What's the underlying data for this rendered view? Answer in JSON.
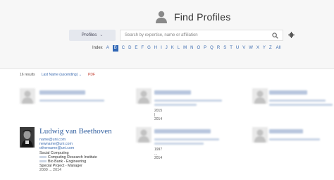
{
  "header": {
    "title": "Find Profiles",
    "title_icon": "person-icon"
  },
  "search": {
    "dropdown_label": "Profiles",
    "placeholder": "Search by expertise, name or affiliation",
    "search_icon": "search-icon",
    "settings_icon": "gear-icon"
  },
  "index": {
    "label": "Index",
    "letters": [
      "A",
      "B",
      "C",
      "D",
      "E",
      "F",
      "G",
      "H",
      "I",
      "J",
      "K",
      "L",
      "M",
      "N",
      "O",
      "P",
      "Q",
      "R",
      "S",
      "T",
      "U",
      "V",
      "W",
      "X",
      "Y",
      "Z"
    ],
    "active": "B",
    "all_label": "All"
  },
  "results": {
    "count_text": "16 results",
    "sort_label": "Last Name (ascending)",
    "pdf_label": "PDF"
  },
  "profiles": [
    {
      "blurred": true,
      "year_text": ""
    },
    {
      "blurred": true,
      "year_text": "2015 | 2014"
    },
    {
      "blurred": true,
      "year_text": ""
    },
    {
      "blurred": false,
      "name": "Ludwig van Beethoven",
      "emails": [
        "name@uni.com",
        "newname@uni.com",
        "othername@uni.com"
      ],
      "details": [
        "Social Computing",
        "Computing Research Institute",
        "Bio Bank - Engineering",
        "Special Project - Manager"
      ],
      "year_text": "2009 ... 2014"
    },
    {
      "blurred": true,
      "year_text": "1997 ... 2014"
    },
    {
      "blurred": true,
      "year_text": ""
    }
  ],
  "colors": {
    "accent": "#2f66b5",
    "link": "#3b6bb0",
    "name": "#2f5d9e",
    "header_bg": "#f7f7f7"
  }
}
